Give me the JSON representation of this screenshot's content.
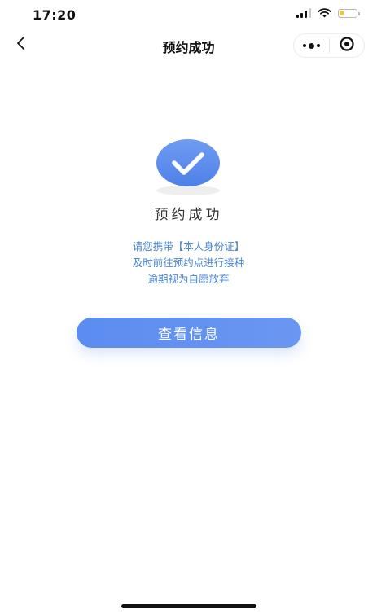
{
  "status_bar": {
    "time": "17:20",
    "icons": [
      "signal-icon",
      "wifi-icon",
      "battery-icon"
    ]
  },
  "nav": {
    "title": "预约成功",
    "back_icon": "chevron-left-icon",
    "capsule_icons": [
      "more-dots-icon",
      "close-circle-icon"
    ]
  },
  "result": {
    "icon": "check-icon",
    "title": "预约成功",
    "notice_lines": [
      "请您携带【本人身份证】",
      "及时前往预约点进行接种",
      "逾期视为自愿放弃"
    ]
  },
  "actions": {
    "view_info_label": "查看信息"
  },
  "colors": {
    "accent": "#5b8cf0",
    "notice_text": "#4a86d4",
    "battery_level": "#f5c242"
  }
}
